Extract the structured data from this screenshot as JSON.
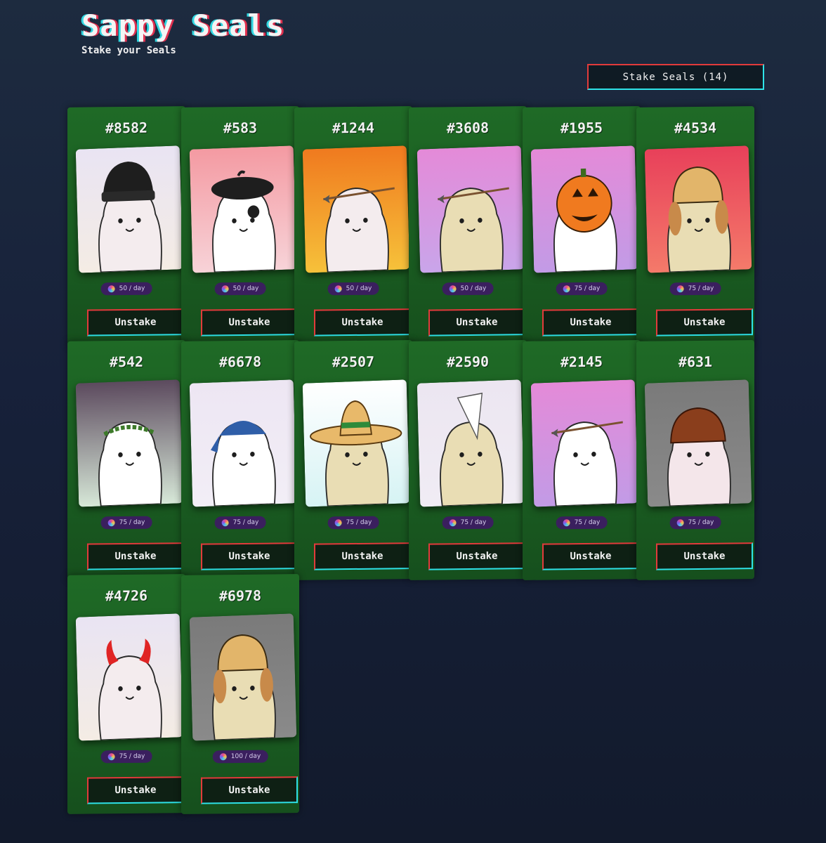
{
  "header": {
    "title": "Sappy Seals",
    "subtitle": "Stake your Seals",
    "stake_button_label": "Stake Seals (14)"
  },
  "colors": {
    "card_green": "#1f6a26",
    "button_border_cyan": "#2ee3e8",
    "button_border_red": "#e23b3b",
    "rate_badge_bg": "#3a1f5e"
  },
  "seals": [
    {
      "id": "#8582",
      "rate": "50 / day",
      "button": "Unstake",
      "bg": [
        "#e9e4f3",
        "#f4ece4"
      ],
      "body": "#f4ecee",
      "hat": "beanie"
    },
    {
      "id": "#583",
      "rate": "50 / day",
      "button": "Unstake",
      "bg": [
        "#f49aa2",
        "#f7d3d8"
      ],
      "body": "#ffffff",
      "hat": "beret"
    },
    {
      "id": "#1244",
      "rate": "50 / day",
      "button": "Unstake",
      "bg": [
        "#f07a1f",
        "#f6c13a"
      ],
      "body": "#f4ecee",
      "hat": "arrow"
    },
    {
      "id": "#3608",
      "rate": "50 / day",
      "button": "Unstake",
      "bg": [
        "#e48ad8",
        "#c9a5ea"
      ],
      "body": "#e9ddb4",
      "hat": "arrow"
    },
    {
      "id": "#1955",
      "rate": "75 / day",
      "button": "Unstake",
      "bg": [
        "#e48ad8",
        "#c29be6"
      ],
      "body": "#ffffff",
      "hat": "pumpkin"
    },
    {
      "id": "#4534",
      "rate": "75 / day",
      "button": "Unstake",
      "bg": [
        "#e8405a",
        "#f47a6a"
      ],
      "body": "#e9ddb4",
      "hat": "ushanka"
    },
    {
      "id": "#542",
      "rate": "75 / day",
      "button": "Unstake",
      "bg": [
        "#5c4a5e",
        "#d7e8d8"
      ],
      "body": "#ffffff",
      "hat": "laurel"
    },
    {
      "id": "#6678",
      "rate": "75 / day",
      "button": "Unstake",
      "bg": [
        "#ede6f3",
        "#f2eef6"
      ],
      "body": "#ffffff",
      "hat": "bandana"
    },
    {
      "id": "#2507",
      "rate": "75 / day",
      "button": "Unstake",
      "bg": [
        "#ffffff",
        "#d6f3f4"
      ],
      "body": "#e9ddb4",
      "hat": "sombrero"
    },
    {
      "id": "#2590",
      "rate": "75 / day",
      "button": "Unstake",
      "bg": [
        "#ece6f1",
        "#f0ecf4"
      ],
      "body": "#e9ddb4",
      "hat": "dunce"
    },
    {
      "id": "#2145",
      "rate": "75 / day",
      "button": "Unstake",
      "bg": [
        "#e48ad8",
        "#c29be6"
      ],
      "body": "#ffffff",
      "hat": "arrow"
    },
    {
      "id": "#631",
      "rate": "75 / day",
      "button": "Unstake",
      "bg": [
        "#7a7a7a",
        "#8a8a8a"
      ],
      "body": "#f4e6ea",
      "hat": "mushroom"
    },
    {
      "id": "#4726",
      "rate": "75 / day",
      "button": "Unstake",
      "bg": [
        "#e9e4f3",
        "#f4ece4"
      ],
      "body": "#f4ecee",
      "hat": "horns"
    },
    {
      "id": "#6978",
      "rate": "100 / day",
      "button": "Unstake",
      "bg": [
        "#7a7a7a",
        "#8a8a8a"
      ],
      "body": "#e9ddb4",
      "hat": "ushanka"
    }
  ]
}
